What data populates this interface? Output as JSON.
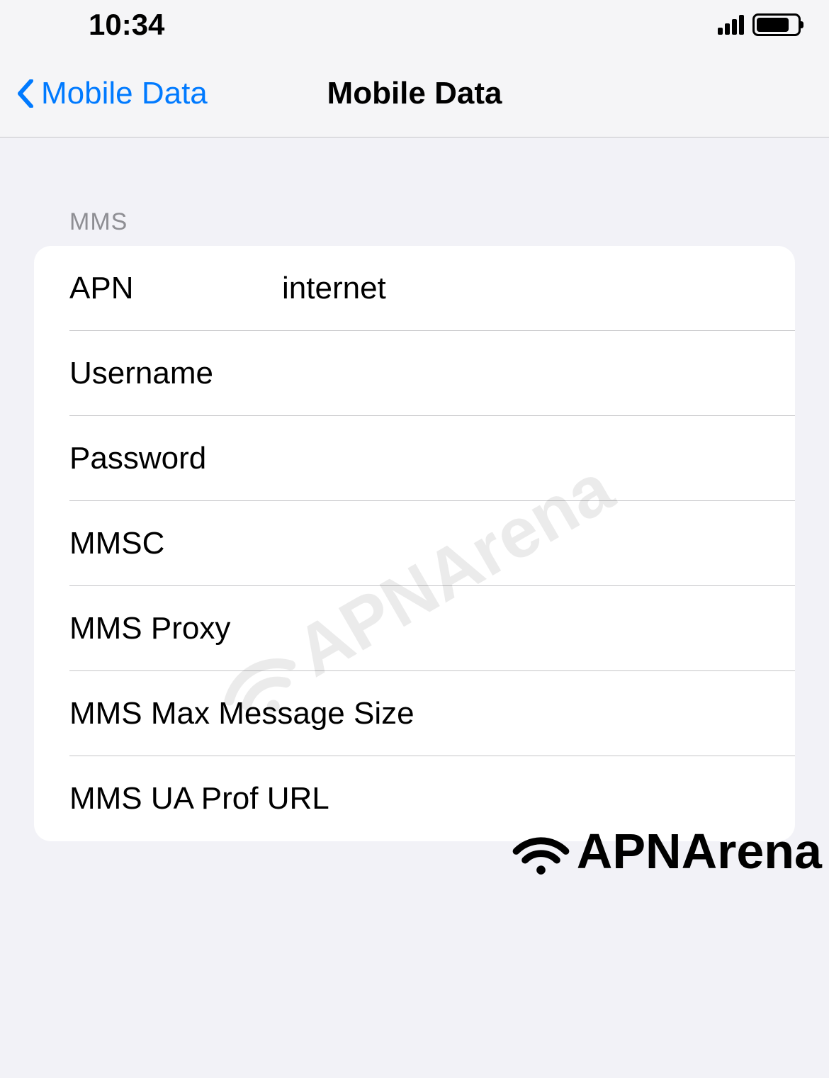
{
  "status": {
    "time": "10:34"
  },
  "nav": {
    "back_label": "Mobile Data",
    "title": "Mobile Data"
  },
  "section_header": "MMS",
  "fields": {
    "apn": {
      "label": "APN",
      "value": "internet"
    },
    "username": {
      "label": "Username",
      "value": ""
    },
    "password": {
      "label": "Password",
      "value": ""
    },
    "mmsc": {
      "label": "MMSC",
      "value": ""
    },
    "mms_proxy": {
      "label": "MMS Proxy",
      "value": ""
    },
    "mms_max": {
      "label": "MMS Max Message Size",
      "value": ""
    },
    "mms_ua": {
      "label": "MMS UA Prof URL",
      "value": ""
    }
  },
  "watermark": "APNArena",
  "footer_logo": "APNArena"
}
